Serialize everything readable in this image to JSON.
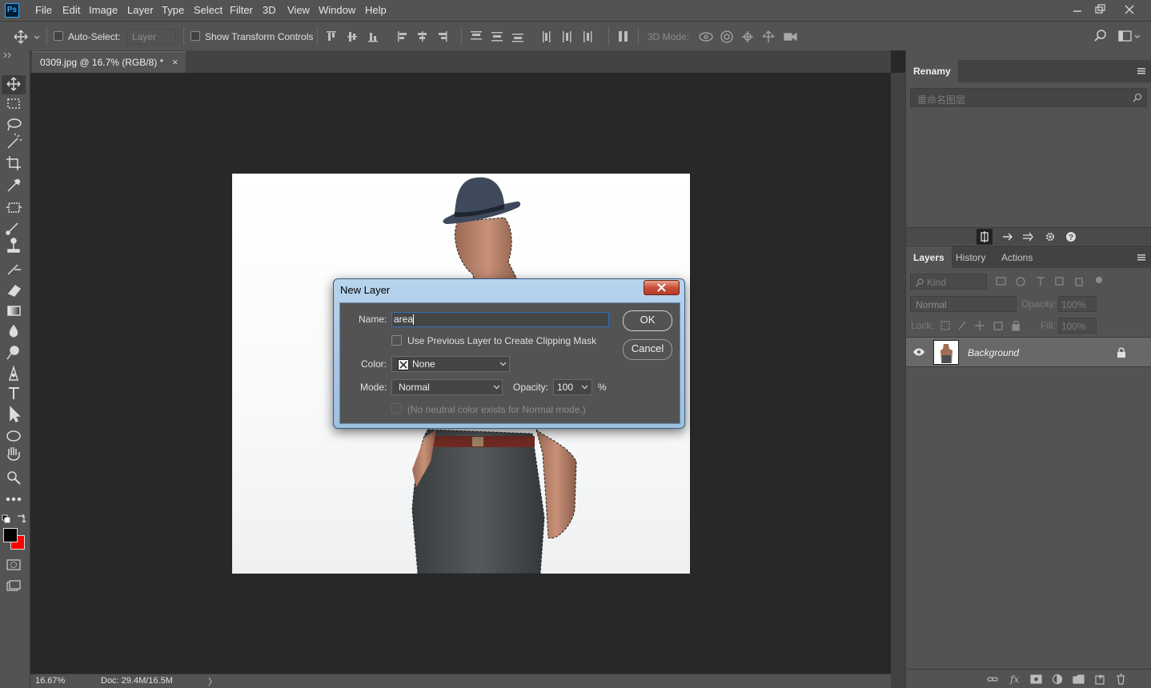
{
  "app": {
    "logo": "Ps"
  },
  "menu": [
    "File",
    "Edit",
    "Image",
    "Layer",
    "Type",
    "Select",
    "Filter",
    "3D",
    "View",
    "Window",
    "Help"
  ],
  "options": {
    "auto_select_label": "Auto-Select:",
    "auto_select_value": "Layer",
    "transform_label": "Show Transform Controls",
    "mode_3d_label": "3D Mode:"
  },
  "document": {
    "tab_title": "0309.jpg @ 16.7% (RGB/8) *",
    "close": "×"
  },
  "status": {
    "zoom": "16.67%",
    "doc_size": "Doc: 29.4M/16.5M",
    "arrow": "〉"
  },
  "renamy": {
    "tab": "Renamy",
    "search_placeholder": "重命名图层"
  },
  "layers_panel": {
    "tabs": [
      "Layers",
      "History",
      "Actions"
    ],
    "filter_label": "Kind",
    "blend_mode": "Normal",
    "opacity_label": "Opacity:",
    "opacity_value": "100%",
    "lock_label": "Lock:",
    "fill_label": "Fill:",
    "fill_value": "100%",
    "layers": [
      {
        "name": "Background",
        "visible": true,
        "locked": true
      }
    ]
  },
  "dialog": {
    "title": "New Layer",
    "name_label": "Name:",
    "name_value": "area",
    "clipping_label": "Use Previous Layer to Create Clipping Mask",
    "color_label": "Color:",
    "color_value": "None",
    "mode_label": "Mode:",
    "mode_value": "Normal",
    "opacity_label": "Opacity:",
    "opacity_value": "100",
    "percent": "%",
    "neutral_label": "(No neutral color exists for Normal mode.)",
    "ok_label": "OK",
    "cancel_label": "Cancel"
  },
  "colors": {
    "foreground": "#000000",
    "background": "#ff0000",
    "accent": "#2f6fbf"
  }
}
